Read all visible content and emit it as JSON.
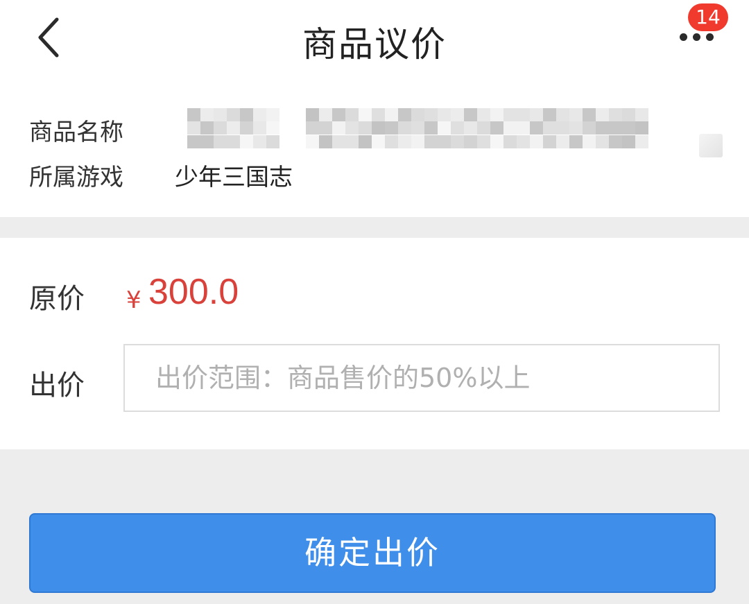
{
  "header": {
    "title": "商品议价",
    "badge_count": "14",
    "back_icon": "chevron-left-icon",
    "more_icon": "more-dots-icon"
  },
  "info": {
    "name_label": "商品名称",
    "game_label": "所属游戏",
    "game_value": "少年三国志"
  },
  "price": {
    "original_label": "原价",
    "currency": "¥",
    "original_value": "300.0",
    "offer_label": "出价",
    "offer_placeholder": "出价范围：商品售价的50%以上",
    "offer_value": ""
  },
  "actions": {
    "confirm_label": "确定出价"
  },
  "colors": {
    "accent": "#3f8fea",
    "price": "#d9413b",
    "badge": "#f03a2e",
    "background": "#ededed"
  }
}
